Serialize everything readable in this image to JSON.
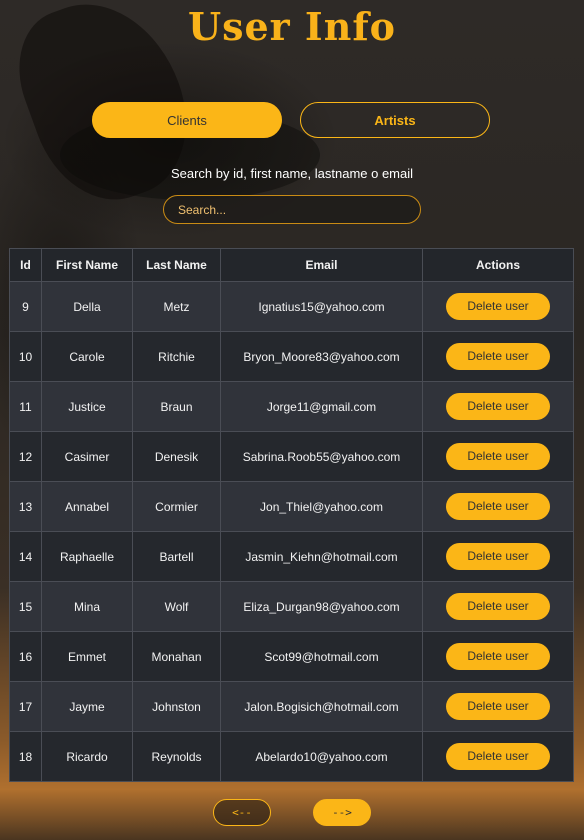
{
  "header": {
    "title": "User Info"
  },
  "tabs": [
    {
      "label": "Clients",
      "active": true
    },
    {
      "label": "Artists",
      "active": false
    }
  ],
  "search": {
    "label": "Search by id, first name, lastname o email",
    "placeholder": "Search...",
    "value": ""
  },
  "table": {
    "columns": [
      "Id",
      "First Name",
      "Last Name",
      "Email",
      "Actions"
    ],
    "rows": [
      {
        "id": "9",
        "first": "Della",
        "last": "Metz",
        "email": "Ignatius15@yahoo.com",
        "action": "Delete user"
      },
      {
        "id": "10",
        "first": "Carole",
        "last": "Ritchie",
        "email": "Bryon_Moore83@yahoo.com",
        "action": "Delete user"
      },
      {
        "id": "11",
        "first": "Justice",
        "last": "Braun",
        "email": "Jorge11@gmail.com",
        "action": "Delete user"
      },
      {
        "id": "12",
        "first": "Casimer",
        "last": "Denesik",
        "email": "Sabrina.Roob55@yahoo.com",
        "action": "Delete user"
      },
      {
        "id": "13",
        "first": "Annabel",
        "last": "Cormier",
        "email": "Jon_Thiel@yahoo.com",
        "action": "Delete user"
      },
      {
        "id": "14",
        "first": "Raphaelle",
        "last": "Bartell",
        "email": "Jasmin_Kiehn@hotmail.com",
        "action": "Delete user"
      },
      {
        "id": "15",
        "first": "Mina",
        "last": "Wolf",
        "email": "Eliza_Durgan98@yahoo.com",
        "action": "Delete user"
      },
      {
        "id": "16",
        "first": "Emmet",
        "last": "Monahan",
        "email": "Scot99@hotmail.com",
        "action": "Delete user"
      },
      {
        "id": "17",
        "first": "Jayme",
        "last": "Johnston",
        "email": "Jalon.Bogisich@hotmail.com",
        "action": "Delete user"
      },
      {
        "id": "18",
        "first": "Ricardo",
        "last": "Reynolds",
        "email": "Abelardo10@yahoo.com",
        "action": "Delete user"
      }
    ]
  },
  "pagination": {
    "prev_label": "<--",
    "next_label": "-->"
  },
  "colors": {
    "accent": "#fbb617",
    "title": "#f9b21a",
    "row_odd": "#30333a",
    "row_even": "#25282d",
    "header_bg": "#23262b"
  }
}
